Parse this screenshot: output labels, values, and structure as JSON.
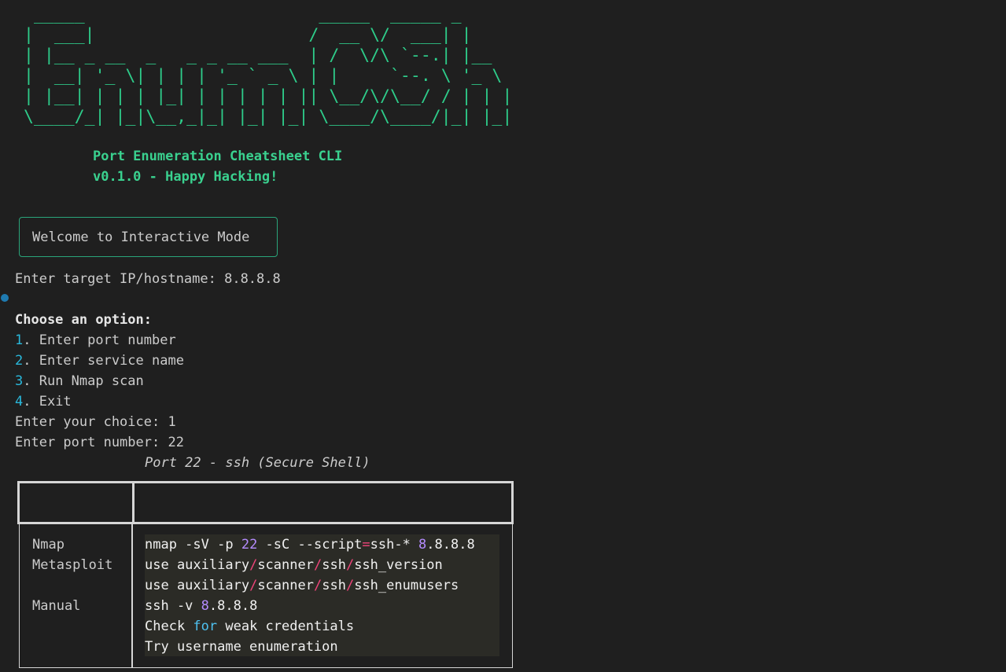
{
  "banner": {
    "ascii": " _____                       _____  _____ _     \n|  ___|                     /  __ \\/  ___| |    \n| |__ _ __  _   _ _ __ ___  | /  \\/\\ `--.| |__  \n|  __| '_ \\| | | | '_ ` _ \\ | |     `--. \\ '_ \\ \n| |__| | | | |_| | | | | | || \\__/\\/\\__/ / | | |\n\\____/_| |_|\\__,_|_| |_| |_| \\____/\\____/|_| |_|",
    "subtitle": "Port Enumeration Cheatsheet CLI",
    "version": "v0.1.0 - Happy Hacking!"
  },
  "welcome": "Welcome to Interactive Mode",
  "target_prompt": "Enter target IP/hostname: 8.8.8.8",
  "menu": {
    "heading": "Choose an option:",
    "items": [
      {
        "num": "1",
        "label": ". Enter port number"
      },
      {
        "num": "2",
        "label": ". Enter service name"
      },
      {
        "num": "3",
        "label": ". Run Nmap scan"
      },
      {
        "num": "4",
        "label": ". Exit"
      }
    ]
  },
  "choice_prompt": "Enter your choice: 1",
  "port_prompt": "Enter port number: 22",
  "table": {
    "caption": "Port 22 - ssh (Secure Shell)",
    "headers": [
      "",
      ""
    ],
    "tools": [
      "Nmap",
      "Metasploit",
      "Manual"
    ],
    "cmd_nmap": {
      "a": "nmap -sV -p ",
      "port": "22",
      "b": " -sC --script",
      "eq": "=",
      "c": "ssh-* ",
      "ip_first": "8",
      "ip_rest": ".8.8.8"
    },
    "cmd_msf1": {
      "a": "use auxiliary",
      "s1": "/",
      "b": "scanner",
      "s2": "/",
      "c": "ssh",
      "s3": "/",
      "d": "ssh_version"
    },
    "cmd_msf2": {
      "a": "use auxiliary",
      "s1": "/",
      "b": "scanner",
      "s2": "/",
      "c": "ssh",
      "s3": "/",
      "d": "ssh_enumusers"
    },
    "cmd_manual1": {
      "a": "ssh -v ",
      "ip_first": "8",
      "ip_rest": ".8.8.8"
    },
    "cmd_manual2": {
      "a": "Check ",
      "kw": "for",
      "b": " weak credentials"
    },
    "cmd_manual3": "Try username enumeration"
  },
  "colors": {
    "banner": "#2ecc8a",
    "menu_number": "#29b8db",
    "number_literal": "#b58cff",
    "slash": "#f0447a",
    "keyword": "#4ec1f0"
  }
}
